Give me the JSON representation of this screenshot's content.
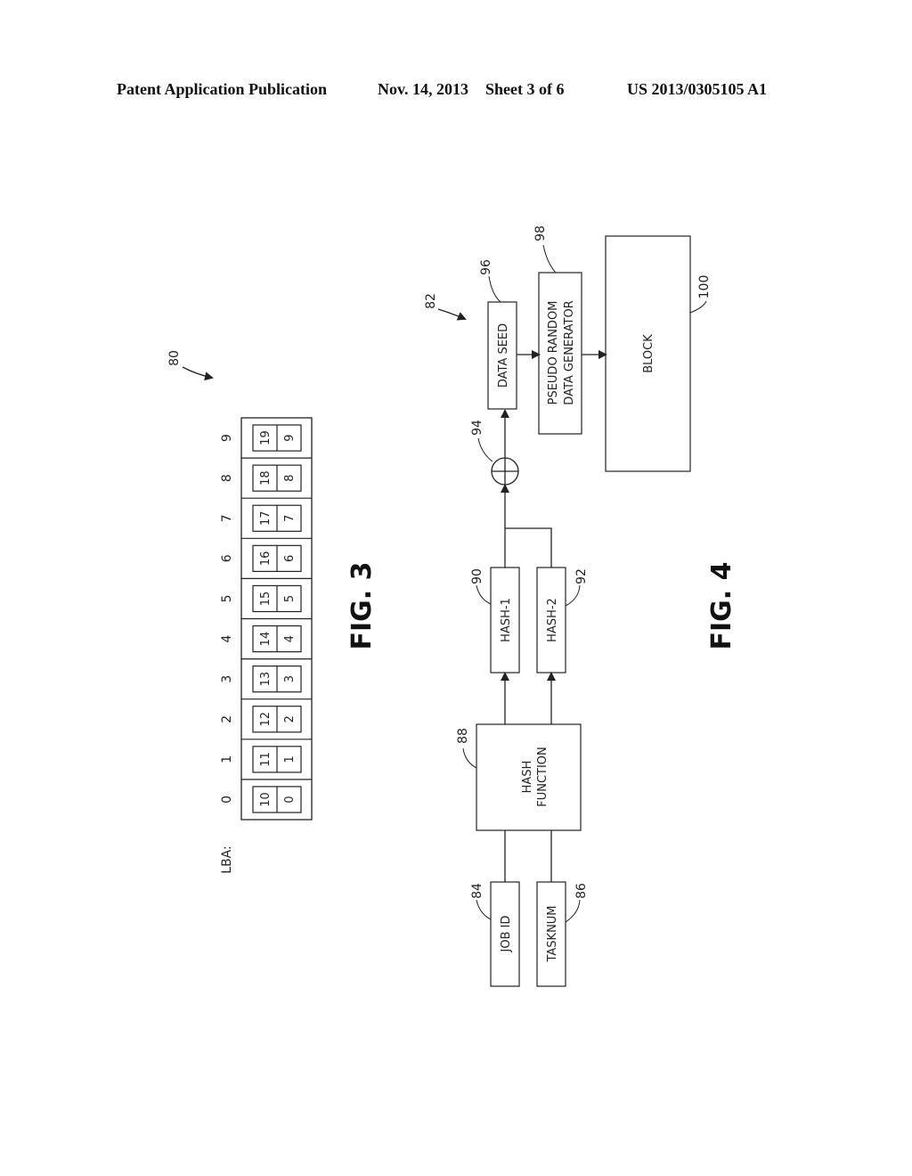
{
  "header": {
    "publication": "Patent Application Publication",
    "date": "Nov. 14, 2013",
    "sheet": "Sheet 3 of 6",
    "number": "US 2013/0305105 A1"
  },
  "fig3": {
    "label": "FIG. 3",
    "ref": "80",
    "lba_label": "LBA:",
    "cells": [
      {
        "lba": "0",
        "top": "10",
        "bottom": "0"
      },
      {
        "lba": "1",
        "top": "11",
        "bottom": "1"
      },
      {
        "lba": "2",
        "top": "12",
        "bottom": "2"
      },
      {
        "lba": "3",
        "top": "13",
        "bottom": "3"
      },
      {
        "lba": "4",
        "top": "14",
        "bottom": "4"
      },
      {
        "lba": "5",
        "top": "15",
        "bottom": "5"
      },
      {
        "lba": "6",
        "top": "16",
        "bottom": "6"
      },
      {
        "lba": "7",
        "top": "17",
        "bottom": "7"
      },
      {
        "lba": "8",
        "top": "18",
        "bottom": "8"
      },
      {
        "lba": "9",
        "top": "19",
        "bottom": "9"
      }
    ]
  },
  "fig4": {
    "label": "FIG. 4",
    "ref": "82",
    "blocks": {
      "job_id": {
        "text": "JOB ID",
        "ref": "84"
      },
      "tasknum": {
        "text": "TASKNUM",
        "ref": "86"
      },
      "hash_function": {
        "line1": "HASH",
        "line2": "FUNCTION",
        "ref": "88"
      },
      "hash1": {
        "text": "HASH-1",
        "ref": "90"
      },
      "hash2": {
        "text": "HASH-2",
        "ref": "92"
      },
      "xor": {
        "ref": "94"
      },
      "data_seed": {
        "text": "DATA SEED",
        "ref": "96"
      },
      "prng": {
        "line1": "PSEUDO RANDOM",
        "line2": "DATA GENERATOR",
        "ref": "98"
      },
      "block": {
        "text": "BLOCK",
        "ref": "100"
      }
    }
  }
}
